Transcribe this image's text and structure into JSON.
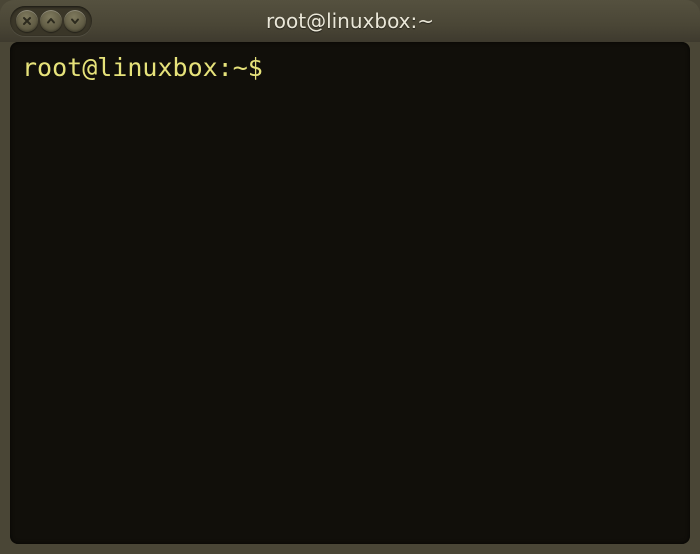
{
  "window": {
    "title": "root@linuxbox:~",
    "controls": {
      "close_icon": "close",
      "maximize_icon": "chevron-up",
      "minimize_icon": "chevron-down"
    }
  },
  "terminal": {
    "prompt": "root@linuxbox:~$",
    "input": ""
  },
  "colors": {
    "titlebar_bg": "#4a4636",
    "terminal_bg": "#110f0a",
    "prompt_fg": "#e6e27a"
  }
}
